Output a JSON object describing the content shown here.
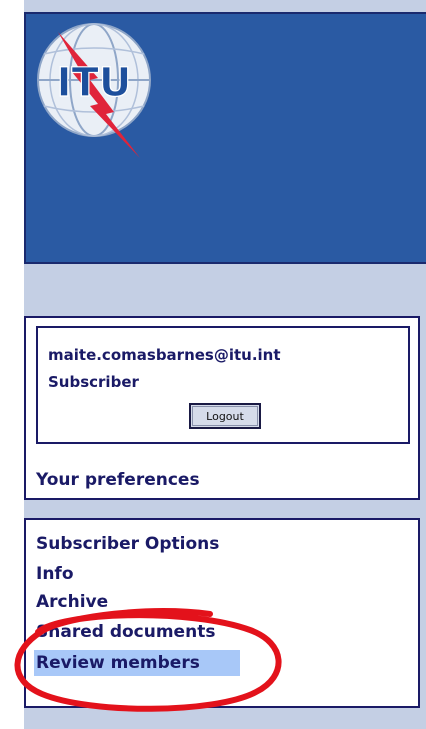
{
  "header": {
    "logo_text": "ITU",
    "logo_icon": "itu-globe-logo-icon"
  },
  "user_box": {
    "email": "maite.comasbarnes@itu.int",
    "role": "Subscriber",
    "logout_label": "Logout",
    "preferences_label": "Your preferences"
  },
  "options_menu": {
    "items": [
      {
        "label": "Subscriber Options"
      },
      {
        "label": "Info"
      },
      {
        "label": "Archive"
      },
      {
        "label": "Shared documents"
      },
      {
        "label": "Review members"
      }
    ],
    "selected_index": 4
  },
  "colors": {
    "banner": "#2a5aa3",
    "page_background": "#c4cfe4",
    "text": "#1a1a66",
    "highlight": "#a8c8f8",
    "annotation": "#e3121b"
  }
}
